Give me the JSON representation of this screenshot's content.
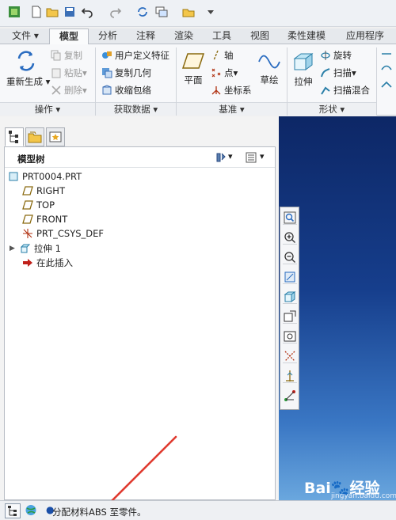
{
  "ribbon_tabs": [
    "文件",
    "模型",
    "分析",
    "注释",
    "渲染",
    "工具",
    "视图",
    "柔性建模",
    "应用程序"
  ],
  "ribbon": {
    "regenerate": "重新生成",
    "copy": "复制",
    "paste": "粘贴",
    "delete": "删除",
    "user_defined_feature": "用户定义特征",
    "copy_geometry": "复制几何",
    "shrinkwrap": "收缩包络",
    "plane": "平面",
    "axis": "轴",
    "point": "点",
    "coord_sys": "坐标系",
    "sketch": "草绘",
    "extrude": "拉伸",
    "revolve": "旋转",
    "sweep": "扫描",
    "swept_blend": "扫描混合",
    "groups": {
      "operations": "操作",
      "get_data": "获取数据",
      "datum": "基准",
      "shapes": "形状"
    }
  },
  "tree": {
    "title": "模型树",
    "items": [
      "PRT0004.PRT",
      "RIGHT",
      "TOP",
      "FRONT",
      "PRT_CSYS_DEF",
      "拉伸 1",
      "在此插入"
    ]
  },
  "status": {
    "message": "分配材料ABS 至零件。"
  },
  "watermark": {
    "brand": "Bai",
    "brand2": "经验",
    "url": "jingyan.baidu.com"
  },
  "colors": {
    "viewport_top": "#0d2766",
    "viewport_bottom": "#6aa7de",
    "accent_red": "#e03a2f"
  }
}
